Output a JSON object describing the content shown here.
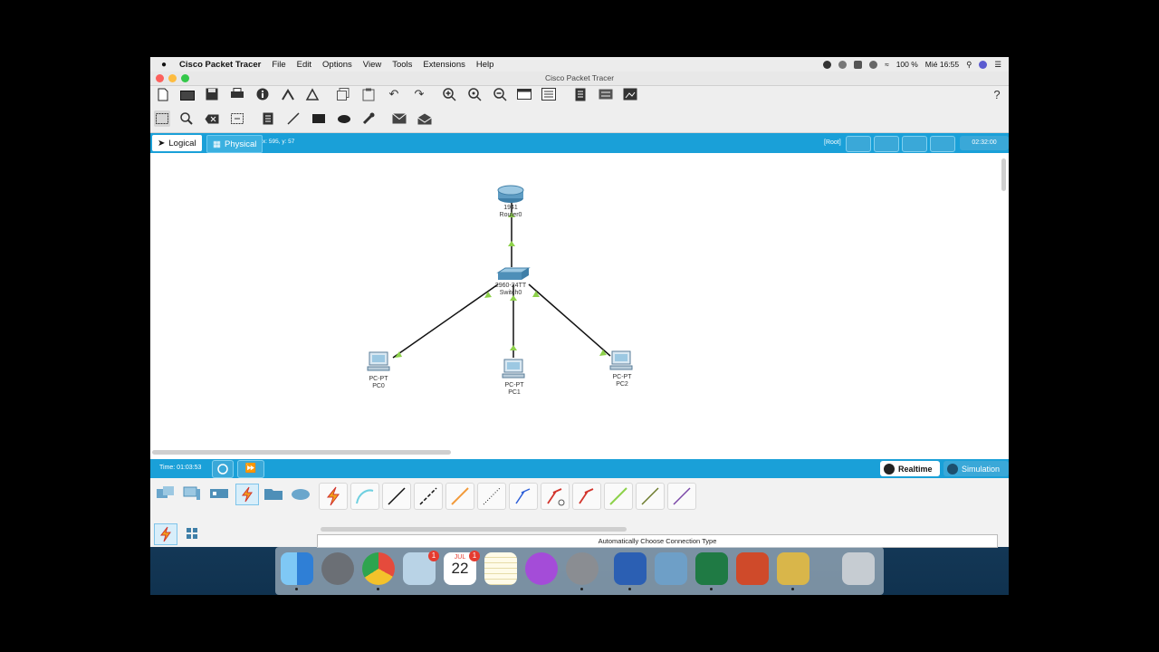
{
  "menubar": {
    "app_name": "Cisco Packet Tracer",
    "menus": [
      "File",
      "Edit",
      "Options",
      "View",
      "Tools",
      "Extensions",
      "Help"
    ],
    "battery": "100 %",
    "clock": "Mié 16:55"
  },
  "window": {
    "title": "Cisco Packet Tracer"
  },
  "tabs": {
    "logical": "Logical",
    "physical": "Physical",
    "coords": "x: 595, y: 57",
    "root": "[Root]",
    "clock": "02:32:00"
  },
  "topology": {
    "devices": [
      {
        "id": "router0",
        "model": "1941",
        "name": "Router0",
        "icon": "router-icon"
      },
      {
        "id": "switch0",
        "model": "2960-24TT",
        "name": "Switch0",
        "icon": "switch-icon"
      },
      {
        "id": "pc0",
        "model": "PC-PT",
        "name": "PC0",
        "icon": "pc-icon"
      },
      {
        "id": "pc1",
        "model": "PC-PT",
        "name": "PC1",
        "icon": "pc-icon"
      },
      {
        "id": "pc2",
        "model": "PC-PT",
        "name": "PC2",
        "icon": "pc-icon"
      }
    ],
    "link_color": "#8dd14a"
  },
  "status": {
    "time": "Time: 01:03:53",
    "realtime": "Realtime",
    "simulation": "Simulation"
  },
  "panel": {
    "connection_hint": "Automatically Choose Connection Type"
  },
  "dock": {
    "mail_badge": "1",
    "calendar_badge": "1",
    "calendar_month": "JUL",
    "calendar_day": "22"
  },
  "colors": {
    "accent": "#1aa0d8"
  }
}
